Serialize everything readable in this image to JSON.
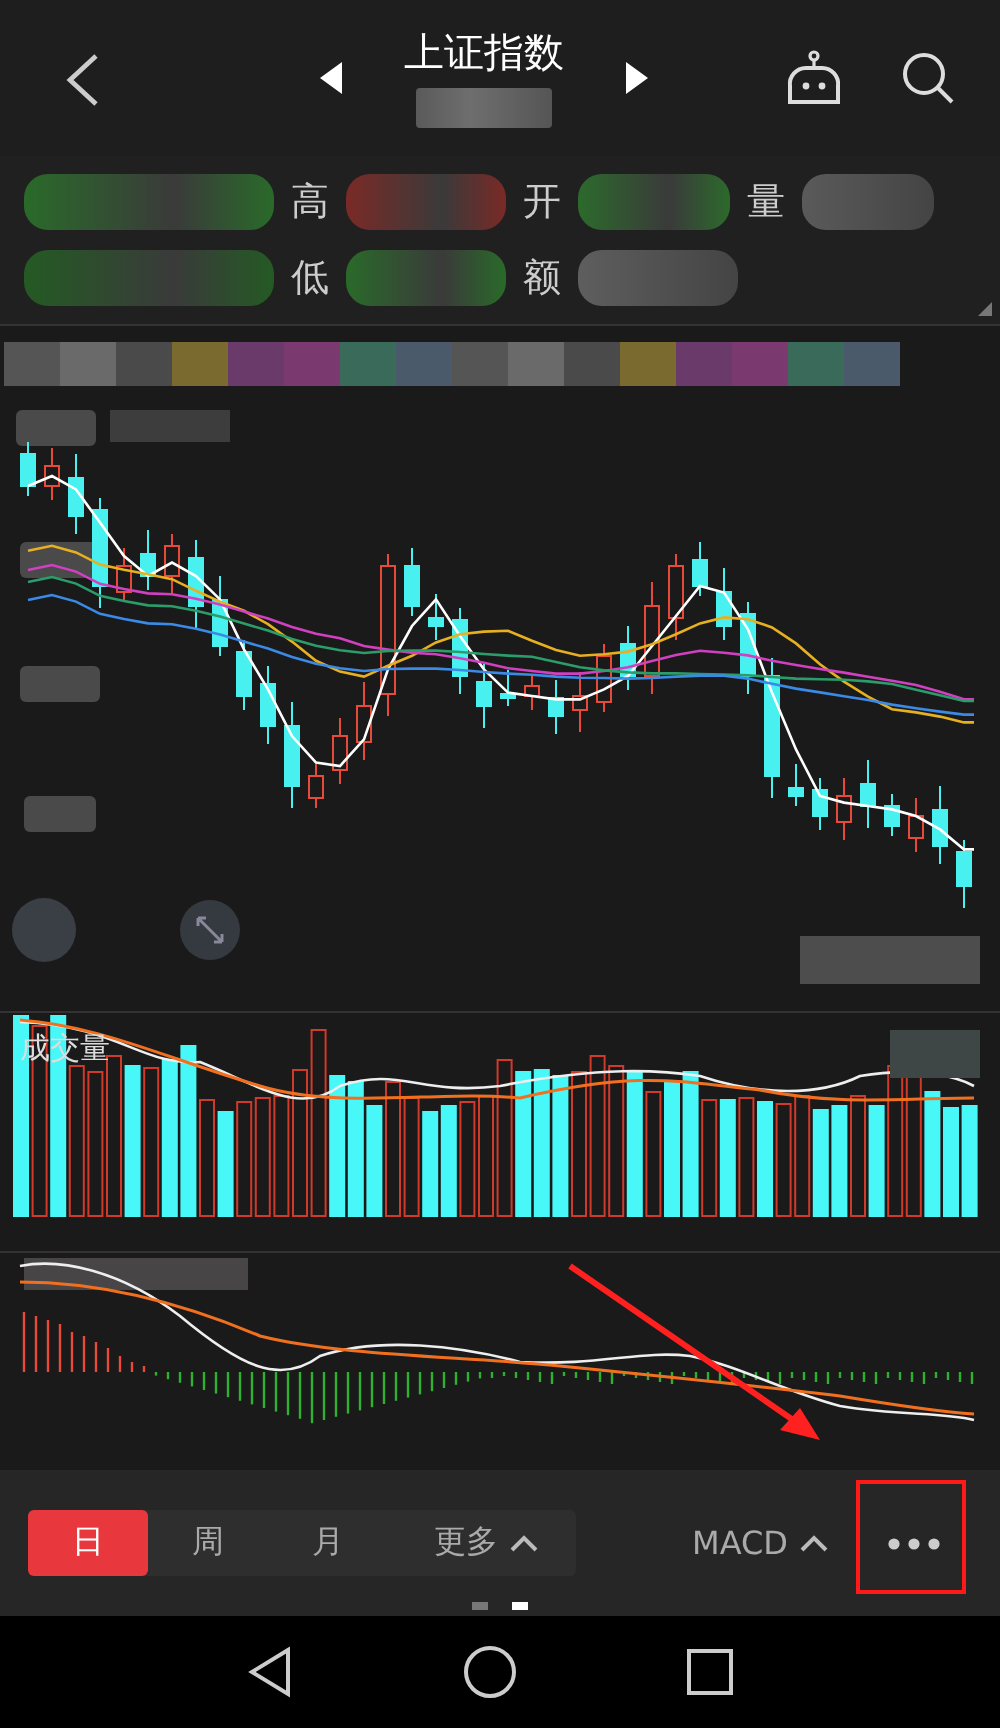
{
  "header": {
    "title": "上证指数"
  },
  "quote": {
    "rows": [
      [
        {
          "label": "高"
        },
        {
          "label": "开"
        },
        {
          "label": "量"
        }
      ],
      [
        {
          "label": "低"
        },
        {
          "label": "额"
        }
      ]
    ]
  },
  "chart": {
    "volume_label": "成交量"
  },
  "periods": [
    {
      "label": "日",
      "selected": true
    },
    {
      "label": "周",
      "selected": false
    },
    {
      "label": "月",
      "selected": false
    },
    {
      "label": "更多",
      "selected": false
    }
  ],
  "indicator": {
    "label": "MACD"
  },
  "pages": [
    {
      "selected": false
    },
    {
      "selected": true
    }
  ],
  "annotations": {
    "arrow": true,
    "box": true
  }
}
